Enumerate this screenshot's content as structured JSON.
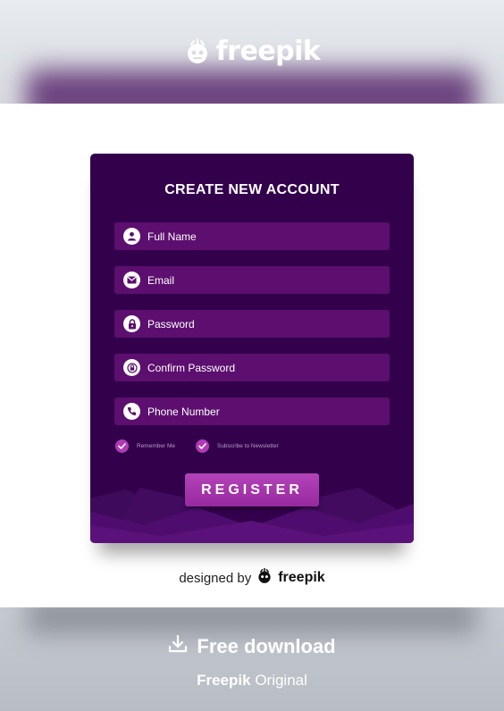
{
  "header": {
    "brand": "freepik"
  },
  "form": {
    "title": "CREATE NEW ACCOUNT",
    "fields": [
      {
        "placeholder": "Full Name",
        "icon": "user-icon"
      },
      {
        "placeholder": "Email",
        "icon": "envelope-icon"
      },
      {
        "placeholder": "Password",
        "icon": "lock-icon"
      },
      {
        "placeholder": "Confirm Password",
        "icon": "lock-refresh-icon"
      },
      {
        "placeholder": "Phone Number",
        "icon": "phone-icon"
      }
    ],
    "checkboxes": [
      {
        "label": "Remember Me",
        "checked": true
      },
      {
        "label": "Subscribe to Newsletter",
        "checked": true
      }
    ],
    "submit_label": "REGISTER"
  },
  "credit": {
    "prefix": "designed by",
    "brand": "freepik"
  },
  "footer": {
    "download_label": "Free download",
    "original_brand": "Freepik",
    "original_suffix": "Original"
  },
  "colors": {
    "card_bg": "#33004c",
    "field_bg": "#5c0f6e",
    "accent": "#b03bb5"
  }
}
